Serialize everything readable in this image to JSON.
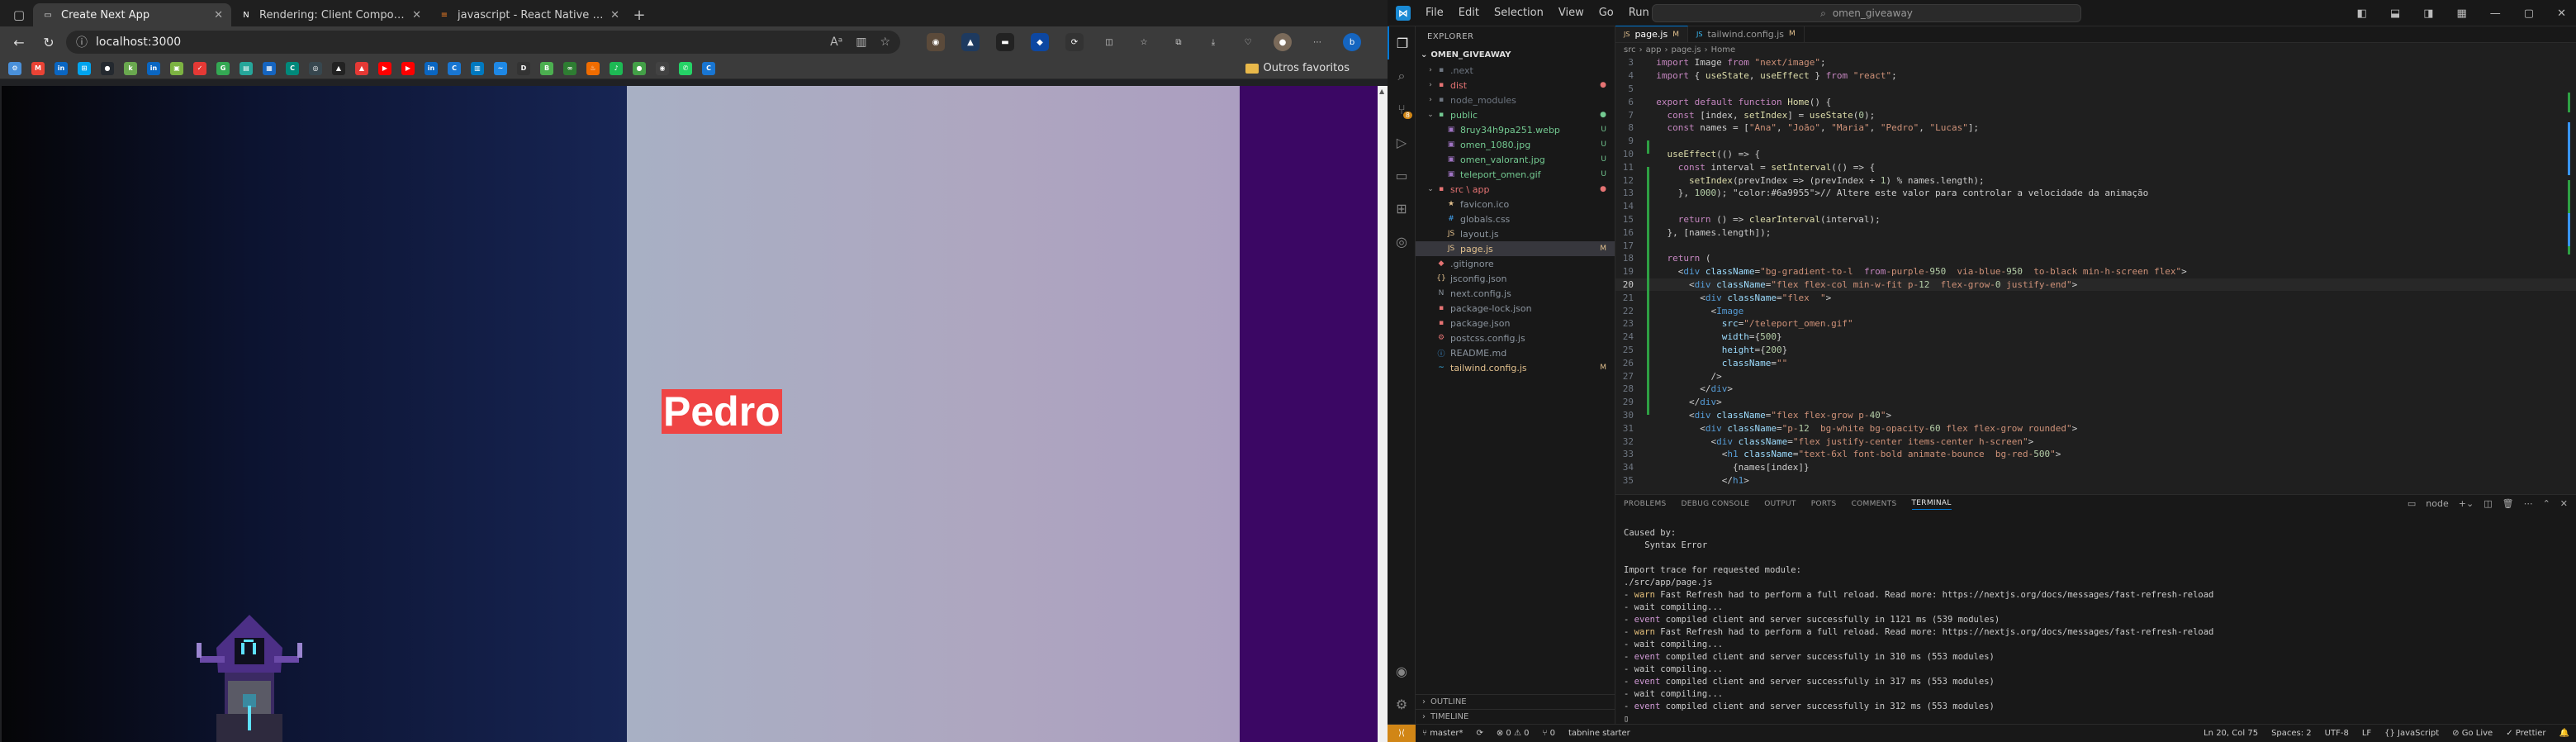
{
  "browser": {
    "tabs": [
      {
        "title": "Create Next App",
        "active": true,
        "favicon": "page-icon",
        "favicon_color": "#dddddd"
      },
      {
        "title": "Rendering: Client Components |",
        "active": false,
        "favicon": "nextjs-icon",
        "favicon_color": "#ffffff"
      },
      {
        "title": "javascript - React Native - \"Rou…",
        "active": false,
        "favicon": "stackoverflow-icon",
        "favicon_color": "#f48024"
      }
    ],
    "url": "localhost:3000",
    "bookmarks_folder": "Outros favoritos",
    "bookmarks": [
      {
        "icon": "gear-icon",
        "color": "#4a90d9",
        "glyph": "⚙"
      },
      {
        "icon": "gmail-icon",
        "color": "#ea4335",
        "glyph": "M"
      },
      {
        "icon": "linkedin-icon",
        "color": "#0a66c2",
        "glyph": "in"
      },
      {
        "icon": "windows-icon",
        "color": "#00a4ef",
        "glyph": "⊞"
      },
      {
        "icon": "github-icon",
        "color": "#24292f",
        "glyph": "●"
      },
      {
        "icon": "k-icon",
        "color": "#6aa84f",
        "glyph": "k"
      },
      {
        "icon": "linkedin-icon",
        "color": "#0a66c2",
        "glyph": "in"
      },
      {
        "icon": "game-icon",
        "color": "#7cb342",
        "glyph": "▣"
      },
      {
        "icon": "check-icon",
        "color": "#e53935",
        "glyph": "✓"
      },
      {
        "icon": "g-icon",
        "color": "#34a853",
        "glyph": "G"
      },
      {
        "icon": "chart-icon",
        "color": "#26a69a",
        "glyph": "▤"
      },
      {
        "icon": "cube-icon",
        "color": "#1565c0",
        "glyph": "▦"
      },
      {
        "icon": "ct-icon",
        "color": "#00897b",
        "glyph": "C"
      },
      {
        "icon": "vortex-icon",
        "color": "#37474f",
        "glyph": "◎"
      },
      {
        "icon": "wolf-icon",
        "color": "#222222",
        "glyph": "▲"
      },
      {
        "icon": "warning-icon",
        "color": "#e53935",
        "glyph": "▲"
      },
      {
        "icon": "youtube-icon",
        "color": "#ff0000",
        "glyph": "▶"
      },
      {
        "icon": "youtube-icon",
        "color": "#ff0000",
        "glyph": "▶"
      },
      {
        "icon": "linkedin-icon",
        "color": "#0a66c2",
        "glyph": "in"
      },
      {
        "icon": "c-icon",
        "color": "#1976d2",
        "glyph": "C"
      },
      {
        "icon": "trello-icon",
        "color": "#0079bf",
        "glyph": "▥"
      },
      {
        "icon": "wave-icon",
        "color": "#1e88e5",
        "glyph": "~"
      },
      {
        "icon": "d-icon",
        "color": "#333333",
        "glyph": "D"
      },
      {
        "icon": "book-icon",
        "color": "#4caf50",
        "glyph": "B"
      },
      {
        "icon": "infinity-icon",
        "color": "#2e7d32",
        "glyph": "∞"
      },
      {
        "icon": "fire-icon",
        "color": "#ef6c00",
        "glyph": "♨"
      },
      {
        "icon": "spotify-icon",
        "color": "#1db954",
        "glyph": "♪"
      },
      {
        "icon": "green-icon",
        "color": "#43a047",
        "glyph": "●"
      },
      {
        "icon": "chat-icon",
        "color": "#424242",
        "glyph": "◉"
      },
      {
        "icon": "whatsapp-icon",
        "color": "#25d366",
        "glyph": "✆"
      },
      {
        "icon": "c-icon",
        "color": "#1976d2",
        "glyph": "C"
      }
    ]
  },
  "page": {
    "name": "Pedro"
  },
  "vscode": {
    "menu": [
      "File",
      "Edit",
      "Selection",
      "View",
      "Go",
      "Run",
      "…"
    ],
    "search": "omen_giveaway",
    "explorer_title": "EXPLORER",
    "project": "OMEN_GIVEAWAY",
    "tree": [
      {
        "name": ".next",
        "indent": 1,
        "chev": "›",
        "color": "#6e7681",
        "icon_color": "#6e7681",
        "icon": "▪",
        "status": ""
      },
      {
        "name": "dist",
        "indent": 1,
        "chev": "›",
        "color": "#e57373",
        "icon_color": "#e57373",
        "icon": "▪",
        "status": "●",
        "status_color": "#e57373"
      },
      {
        "name": "node_modules",
        "indent": 1,
        "chev": "›",
        "color": "#6e7681",
        "icon_color": "#6e7681",
        "icon": "▪",
        "status": ""
      },
      {
        "name": "public",
        "indent": 1,
        "chev": "⌄",
        "color": "#73c991",
        "icon_color": "#73c991",
        "icon": "▪",
        "status": "●",
        "status_color": "#73c991"
      },
      {
        "name": "8ruy34h9pa251.webp",
        "indent": 2,
        "chev": "",
        "color": "#73c991",
        "icon_color": "#a074c4",
        "icon": "▣",
        "status": "U",
        "status_color": "#73c991"
      },
      {
        "name": "omen_1080.jpg",
        "indent": 2,
        "chev": "",
        "color": "#73c991",
        "icon_color": "#a074c4",
        "icon": "▣",
        "status": "U",
        "status_color": "#73c991"
      },
      {
        "name": "omen_valorant.jpg",
        "indent": 2,
        "chev": "",
        "color": "#73c991",
        "icon_color": "#a074c4",
        "icon": "▣",
        "status": "U",
        "status_color": "#73c991"
      },
      {
        "name": "teleport_omen.gif",
        "indent": 2,
        "chev": "",
        "color": "#73c991",
        "icon_color": "#a074c4",
        "icon": "▣",
        "status": "U",
        "status_color": "#73c991"
      },
      {
        "name": "src \\ app",
        "indent": 1,
        "chev": "⌄",
        "color": "#e57373",
        "icon_color": "#e57373",
        "icon": "▪",
        "status": "●",
        "status_color": "#e57373"
      },
      {
        "name": "favicon.ico",
        "indent": 2,
        "chev": "",
        "color": "#8b949e",
        "icon_color": "#e2c08d",
        "icon": "★",
        "status": ""
      },
      {
        "name": "globals.css",
        "indent": 2,
        "chev": "",
        "color": "#8b949e",
        "icon_color": "#42a5f5",
        "icon": "#",
        "status": ""
      },
      {
        "name": "layout.js",
        "indent": 2,
        "chev": "",
        "color": "#8b949e",
        "icon_color": "#e2c08d",
        "icon": "JS",
        "status": ""
      },
      {
        "name": "page.js",
        "indent": 2,
        "chev": "",
        "color": "#e2c08d",
        "icon_color": "#e2c08d",
        "icon": "JS",
        "status": "M",
        "status_color": "#e2c08d",
        "selected": true
      },
      {
        "name": ".gitignore",
        "indent": 1,
        "chev": "",
        "color": "#8b949e",
        "icon_color": "#e57373",
        "icon": "◆",
        "status": ""
      },
      {
        "name": "jsconfig.json",
        "indent": 1,
        "chev": "",
        "color": "#8b949e",
        "icon_color": "#e2c08d",
        "icon": "{}",
        "status": ""
      },
      {
        "name": "next.config.js",
        "indent": 1,
        "chev": "",
        "color": "#8b949e",
        "icon_color": "#8b949e",
        "icon": "N",
        "status": ""
      },
      {
        "name": "package-lock.json",
        "indent": 1,
        "chev": "",
        "color": "#8b949e",
        "icon_color": "#e57373",
        "icon": "▪",
        "status": ""
      },
      {
        "name": "package.json",
        "indent": 1,
        "chev": "",
        "color": "#8b949e",
        "icon_color": "#e57373",
        "icon": "▪",
        "status": ""
      },
      {
        "name": "postcss.config.js",
        "indent": 1,
        "chev": "",
        "color": "#8b949e",
        "icon_color": "#e57373",
        "icon": "⚙",
        "status": ""
      },
      {
        "name": "README.md",
        "indent": 1,
        "chev": "",
        "color": "#8b949e",
        "icon_color": "#42a5f5",
        "icon": "ⓘ",
        "status": ""
      },
      {
        "name": "tailwind.config.js",
        "indent": 1,
        "chev": "",
        "color": "#e2c08d",
        "icon_color": "#38bdf8",
        "icon": "~",
        "status": "M",
        "status_color": "#e2c08d"
      }
    ],
    "outline": "OUTLINE",
    "timeline": "TIMELINE",
    "editor_tabs": [
      {
        "label": "page.js",
        "mod": "M",
        "active": true,
        "icon_color": "#e2c08d"
      },
      {
        "label": "tailwind.config.js",
        "mod": "M",
        "active": false,
        "icon_color": "#38bdf8"
      }
    ],
    "breadcrumb": [
      "src",
      "app",
      "page.js",
      "Home"
    ],
    "code_lines": [
      {
        "n": "3",
        "t": "  import Image from \"next/image\";"
      },
      {
        "n": "4",
        "t": "  import { useState, useEffect } from \"react\";"
      },
      {
        "n": "5",
        "t": ""
      },
      {
        "n": "6",
        "t": "  export default function Home() {"
      },
      {
        "n": "7",
        "t": "    const [index, setIndex] = useState(0);"
      },
      {
        "n": "8",
        "t": "    const names = [\"Ana\", \"João\", \"Maria\", \"Pedro\", \"Lucas\"];"
      },
      {
        "n": "9",
        "t": ""
      },
      {
        "n": "10",
        "t": "    useEffect(() => {"
      },
      {
        "n": "11",
        "t": "      const interval = setInterval(() => {"
      },
      {
        "n": "12",
        "t": "        setIndex(prevIndex => (prevIndex + 1) % names.length);"
      },
      {
        "n": "13",
        "t": "      }, 1000); // Altere este valor para controlar a velocidade da animação"
      },
      {
        "n": "14",
        "t": ""
      },
      {
        "n": "15",
        "t": "      return () => clearInterval(interval);"
      },
      {
        "n": "16",
        "t": "    }, [names.length]);"
      },
      {
        "n": "17",
        "t": ""
      },
      {
        "n": "18",
        "t": "    return ("
      },
      {
        "n": "19",
        "t": "      <div className=\"bg-gradient-to-l  from-purple-950  via-blue-950  to-black min-h-screen flex\">"
      },
      {
        "n": "20",
        "t": "        <div className=\"flex flex-col min-w-fit p-12  flex-grow-0 justify-end\">"
      },
      {
        "n": "21",
        "t": "          <div className=\"flex  \">"
      },
      {
        "n": "22",
        "t": "            <Image"
      },
      {
        "n": "23",
        "t": "              src=\"/teleport_omen.gif\""
      },
      {
        "n": "24",
        "t": "              width={500}"
      },
      {
        "n": "25",
        "t": "              height={200}"
      },
      {
        "n": "26",
        "t": "              className=\"\""
      },
      {
        "n": "27",
        "t": "            />"
      },
      {
        "n": "28",
        "t": "          </div>"
      },
      {
        "n": "29",
        "t": "        </div>"
      },
      {
        "n": "30",
        "t": "        <div className=\"flex flex-grow p-40\">"
      },
      {
        "n": "31",
        "t": "          <div className=\"p-12  bg-white bg-opacity-60 flex flex-grow rounded\">"
      },
      {
        "n": "32",
        "t": "            <div className=\"flex justify-center items-center h-screen\">"
      },
      {
        "n": "33",
        "t": "              <h1 className=\"text-6xl font-bold animate-bounce  bg-red-500\">"
      },
      {
        "n": "34",
        "t": "                {names[index]}"
      },
      {
        "n": "35",
        "t": "              </h1>"
      }
    ],
    "current_line": "20",
    "panel_tabs": [
      "PROBLEMS",
      "DEBUG CONSOLE",
      "OUTPUT",
      "PORTS",
      "COMMENTS",
      "TERMINAL"
    ],
    "active_panel_tab": "TERMINAL",
    "terminal_shell": "node",
    "terminal": [
      {
        "p": "",
        "t": "Caused by:"
      },
      {
        "p": "",
        "t": "    Syntax Error"
      },
      {
        "p": "",
        "t": ""
      },
      {
        "p": "",
        "t": "Import trace for requested module:"
      },
      {
        "p": "",
        "t": "./src/app/page.js"
      },
      {
        "p": "warn",
        "t": " Fast Refresh had to perform a full reload. Read more: https://nextjs.org/docs/messages/fast-refresh-reload"
      },
      {
        "p": "wait",
        "t": " compiling..."
      },
      {
        "p": "event",
        "t": " compiled client and server successfully in 1121 ms (539 modules)"
      },
      {
        "p": "warn",
        "t": " Fast Refresh had to perform a full reload. Read more: https://nextjs.org/docs/messages/fast-refresh-reload"
      },
      {
        "p": "wait",
        "t": " compiling..."
      },
      {
        "p": "event",
        "t": " compiled client and server successfully in 310 ms (553 modules)"
      },
      {
        "p": "wait",
        "t": " compiling..."
      },
      {
        "p": "event",
        "t": " compiled client and server successfully in 317 ms (553 modules)"
      },
      {
        "p": "wait",
        "t": " compiling..."
      },
      {
        "p": "event",
        "t": " compiled client and server successfully in 312 ms (553 modules)"
      },
      {
        "p": "",
        "t": "▯"
      }
    ],
    "status": {
      "branch": "master*",
      "sync": "⟳",
      "problems": "⊗ 0 ⚠ 0",
      "ports": "⑂ 0",
      "tailwind": "tabnine starter",
      "position": "Ln 20, Col 75",
      "spaces": "Spaces: 2",
      "encoding": "UTF-8",
      "eol": "LF",
      "language": "{} JavaScript",
      "golive": "⊘ Go Live",
      "prettier": "✓ Prettier"
    }
  }
}
